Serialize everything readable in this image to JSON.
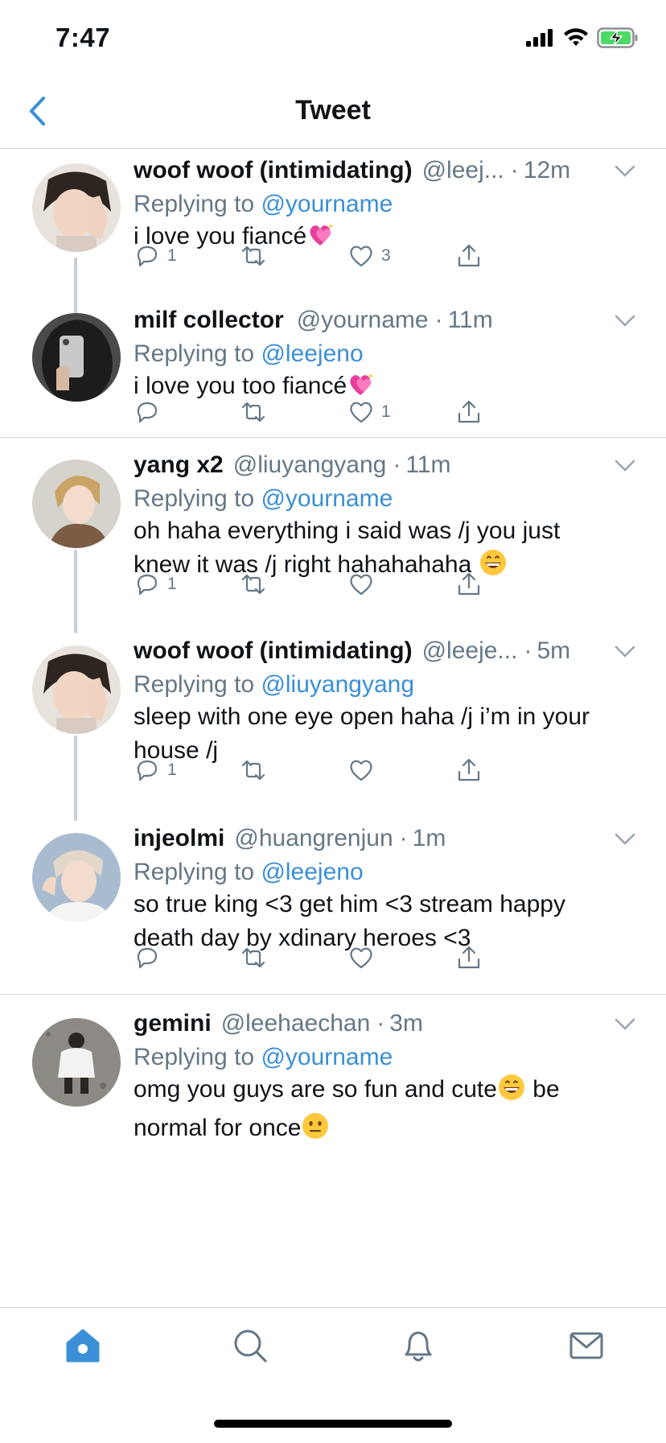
{
  "status": {
    "time": "7:47"
  },
  "header": {
    "title": "Tweet"
  },
  "tweets": [
    {
      "name": "woof woof (intimidating)",
      "handle": "@leej...",
      "time": "12m",
      "replying_prefix": "Replying to",
      "replying_to": "@yourname",
      "text": "i love you fiancé",
      "replies": "1",
      "retweets": "",
      "likes": "3"
    },
    {
      "name": "milf collector",
      "handle": "@yourname",
      "time": "11m",
      "replying_prefix": "Replying to",
      "replying_to": "@leejeno",
      "text": "i love you too fiancé",
      "replies": "",
      "retweets": "",
      "likes": "1"
    },
    {
      "name": "yang x2",
      "handle": "@liuyangyang",
      "time": "11m",
      "replying_prefix": "Replying to",
      "replying_to": "@yourname",
      "text_line1": "oh haha everything i said was /j you just",
      "text_line2": "knew it was /j right hahahahaha",
      "replies": "1",
      "retweets": "",
      "likes": ""
    },
    {
      "name": "woof woof (intimidating)",
      "handle": "@leeje...",
      "time": "5m",
      "replying_prefix": "Replying to",
      "replying_to": "@liuyangyang",
      "text_line1": "sleep with one eye open haha /j i’m in your",
      "text_line2": "house /j",
      "replies": "1",
      "retweets": "",
      "likes": ""
    },
    {
      "name": "injeolmi",
      "handle": "@huangrenjun",
      "time": "1m",
      "replying_prefix": "Replying to",
      "replying_to": "@leejeno",
      "text_line1": "so true king <3 get him <3 stream happy",
      "text_line2": "death day by xdinary heroes <3",
      "replies": "",
      "retweets": "",
      "likes": ""
    },
    {
      "name": "gemini",
      "handle": "@leehaechan",
      "time": "3m",
      "replying_prefix": "Replying to",
      "replying_to": "@yourname",
      "text_line1": "omg you guys are so fun and cute",
      "text_line1b": "be",
      "text_line2": "normal for once"
    }
  ],
  "colors": {
    "accent": "#3a8fd6",
    "muted": "#657786",
    "text": "#0f1419",
    "divider": "#d4d9de"
  },
  "icons": {
    "back": "chevron-left-icon",
    "home": "home-icon",
    "search": "search-icon",
    "notifications": "bell-icon",
    "messages": "mail-icon"
  }
}
